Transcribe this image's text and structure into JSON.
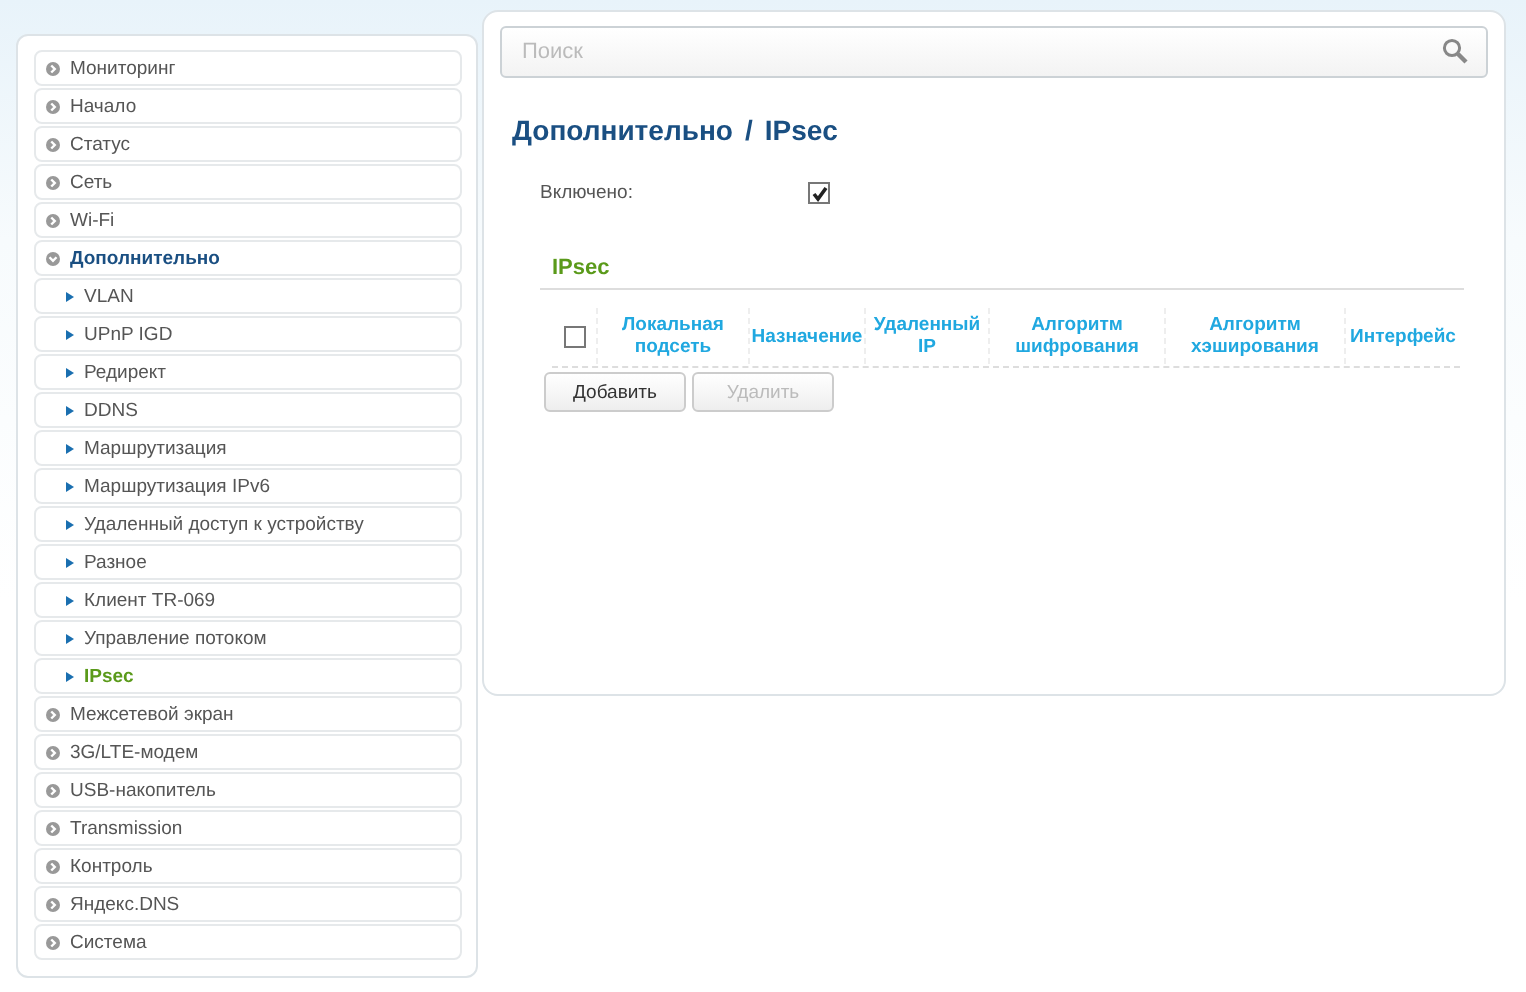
{
  "sidebar": {
    "items": [
      {
        "label": "Мониторинг",
        "expanded": false,
        "selected": false
      },
      {
        "label": "Начало",
        "expanded": false,
        "selected": false
      },
      {
        "label": "Статус",
        "expanded": false,
        "selected": false
      },
      {
        "label": "Сеть",
        "expanded": false,
        "selected": false
      },
      {
        "label": "Wi-Fi",
        "expanded": false,
        "selected": false
      },
      {
        "label": "Дополнительно",
        "expanded": true,
        "selected": false,
        "children": [
          {
            "label": "VLAN",
            "selected": false
          },
          {
            "label": "UPnP IGD",
            "selected": false
          },
          {
            "label": "Редирект",
            "selected": false
          },
          {
            "label": "DDNS",
            "selected": false
          },
          {
            "label": "Маршрутизация",
            "selected": false
          },
          {
            "label": "Маршрутизация IPv6",
            "selected": false
          },
          {
            "label": "Удаленный доступ к устройству",
            "selected": false
          },
          {
            "label": "Разное",
            "selected": false
          },
          {
            "label": "Клиент TR-069",
            "selected": false
          },
          {
            "label": "Управление потоком",
            "selected": false
          },
          {
            "label": "IPsec",
            "selected": true
          }
        ]
      },
      {
        "label": "Межсетевой экран",
        "expanded": false,
        "selected": false
      },
      {
        "label": "3G/LTE-модем",
        "expanded": false,
        "selected": false
      },
      {
        "label": "USB-накопитель",
        "expanded": false,
        "selected": false
      },
      {
        "label": "Transmission",
        "expanded": false,
        "selected": false
      },
      {
        "label": "Контроль",
        "expanded": false,
        "selected": false
      },
      {
        "label": "Яндекс.DNS",
        "expanded": false,
        "selected": false
      },
      {
        "label": "Система",
        "expanded": false,
        "selected": false
      }
    ]
  },
  "search": {
    "placeholder": "Поиск"
  },
  "breadcrumb": [
    "Дополнительно",
    "IPsec"
  ],
  "breadcrumb_separator": "/",
  "enabled": {
    "label": "Включено:",
    "checked": true
  },
  "section_title": "IPsec",
  "table": {
    "select_all": false,
    "columns": [
      "Локальная подсеть",
      "Назначение",
      "Удаленный IP",
      "Алгоритм шифрования",
      "Алгоритм хэширования",
      "Интерфейс"
    ]
  },
  "buttons": [
    {
      "label": "Добавить",
      "disabled": false
    },
    {
      "label": "Удалить",
      "disabled": true
    }
  ]
}
